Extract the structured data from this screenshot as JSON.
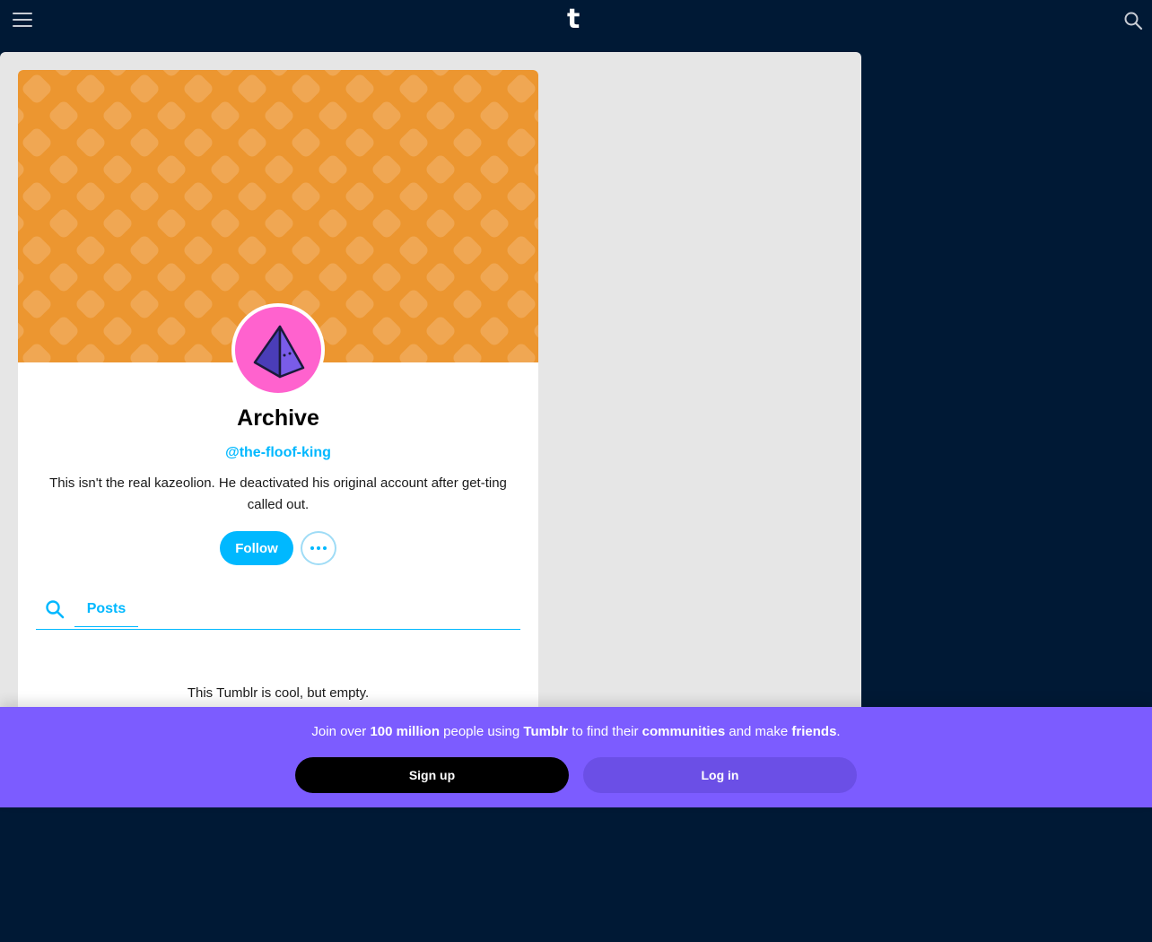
{
  "app": {
    "logo_letter": "t"
  },
  "topbar": {
    "menu_icon": "hamburger-menu-icon",
    "search_icon": "search-icon"
  },
  "colors": {
    "background": "#001935",
    "accent": "#00b8ff",
    "header_orange": "#ec9630",
    "avatar_pink": "#ff62ce",
    "banner_purple": "#7c5cff"
  },
  "blog": {
    "title": "Archive",
    "handle": "@the-floof-king",
    "description": "This isn't the real kazeolion. He deactivated his original account after get-ting called out.",
    "follow_label": "Follow",
    "more_icon": "more-options-icon"
  },
  "tabs": {
    "search_icon": "search-icon",
    "posts_label": "Posts"
  },
  "content": {
    "empty_message": "This Tumblr is cool, but empty."
  },
  "banner": {
    "text_parts": [
      "Join over ",
      "100 million",
      " people using ",
      "Tumblr",
      " to find their ",
      "communities",
      " and make ",
      "friends",
      "."
    ],
    "signup_label": "Sign up",
    "login_label": "Log in"
  }
}
